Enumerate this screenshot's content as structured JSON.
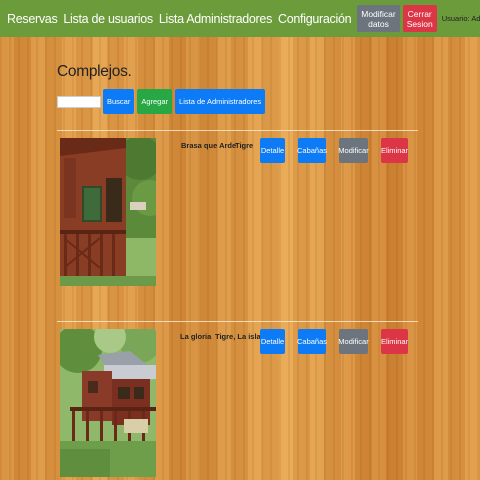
{
  "navbar": {
    "links": [
      "Reservas",
      "Lista de usuarios",
      "Lista Administradores",
      "Configuración"
    ],
    "modify_label": "Modificar datos",
    "logout_label": "Cerrar Sesion",
    "user_text": "Usuario: Admin"
  },
  "page": {
    "title": "Complejos.",
    "search_placeholder": "",
    "search_label": "Buscar",
    "add_label": "Agregar",
    "admin_list_label": "Lista de Administradores"
  },
  "complexes": [
    {
      "name": "Brasa que Arde",
      "location": "Tigre",
      "detail_label": "Detalle",
      "cabins_label": "Cabañas",
      "modify_label": "Modificar",
      "delete_label": "Eliminar"
    },
    {
      "name": "La gloria",
      "location": "Tigre, La isla",
      "detail_label": "Detalle",
      "cabins_label": "Cabañas",
      "modify_label": "Modificar",
      "delete_label": "Eliminar"
    }
  ],
  "colors": {
    "navbar": "#6b9b3a",
    "primary": "#0d7bf5",
    "success": "#28a745",
    "secondary": "#6c757d",
    "danger": "#dc3545"
  }
}
